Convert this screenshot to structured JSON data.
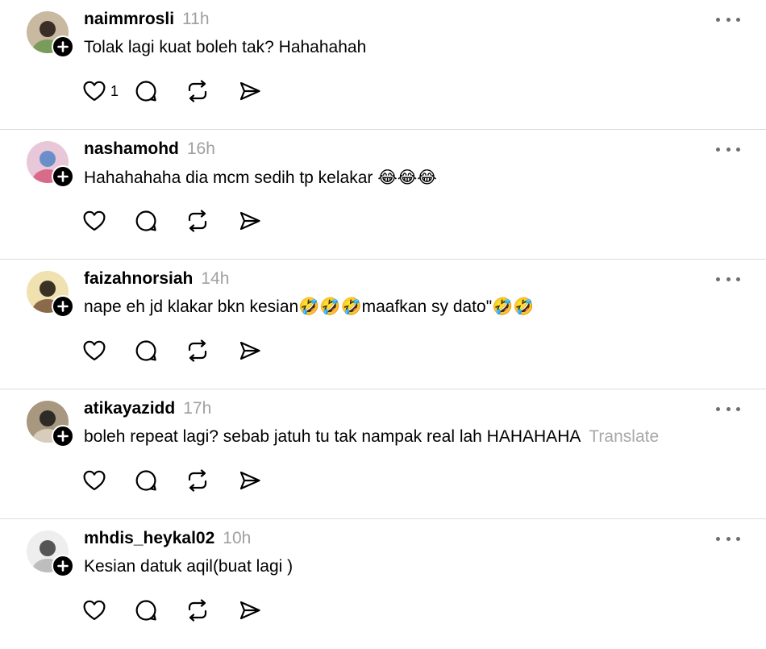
{
  "posts": [
    {
      "username": "naimmrosli",
      "time": "11h",
      "text": "Tolak lagi kuat boleh tak? Hahahahah",
      "translate": "",
      "likes": "1",
      "avatar_colors": [
        "#c8b9a0",
        "#3a2e26",
        "#7a9b5a"
      ]
    },
    {
      "username": "nashamohd",
      "time": "16h",
      "text": "Hahahahaha dia mcm sedih tp kelakar 😂😂😂",
      "translate": "",
      "likes": "",
      "avatar_colors": [
        "#e8c8d8",
        "#6a8fc8",
        "#d86a8a"
      ]
    },
    {
      "username": "faizahnorsiah",
      "time": "14h",
      "text": "nape eh jd klakar bkn kesian🤣🤣🤣maafkan sy dato\"🤣🤣",
      "translate": "",
      "likes": "",
      "avatar_colors": [
        "#f0e2b0",
        "#3b3226",
        "#8a6a4a"
      ]
    },
    {
      "username": "atikayazidd",
      "time": "17h",
      "text": "boleh repeat lagi? sebab jatuh tu tak nampak real lah HAHAHAHA",
      "translate": "Translate",
      "likes": "",
      "avatar_colors": [
        "#a89880",
        "#2e2a26",
        "#d8ccbc"
      ]
    },
    {
      "username": "mhdis_heykal02",
      "time": "10h",
      "text": "Kesian datuk aqil(buat lagi )",
      "translate": "",
      "likes": "",
      "avatar_colors": [
        "#eeeeee",
        "#555555",
        "#bdbdbd"
      ]
    }
  ],
  "icons": {
    "like": "heart-icon",
    "reply": "comment-icon",
    "repost": "repost-icon",
    "share": "send-icon",
    "more": "more-icon",
    "follow": "plus-icon"
  }
}
